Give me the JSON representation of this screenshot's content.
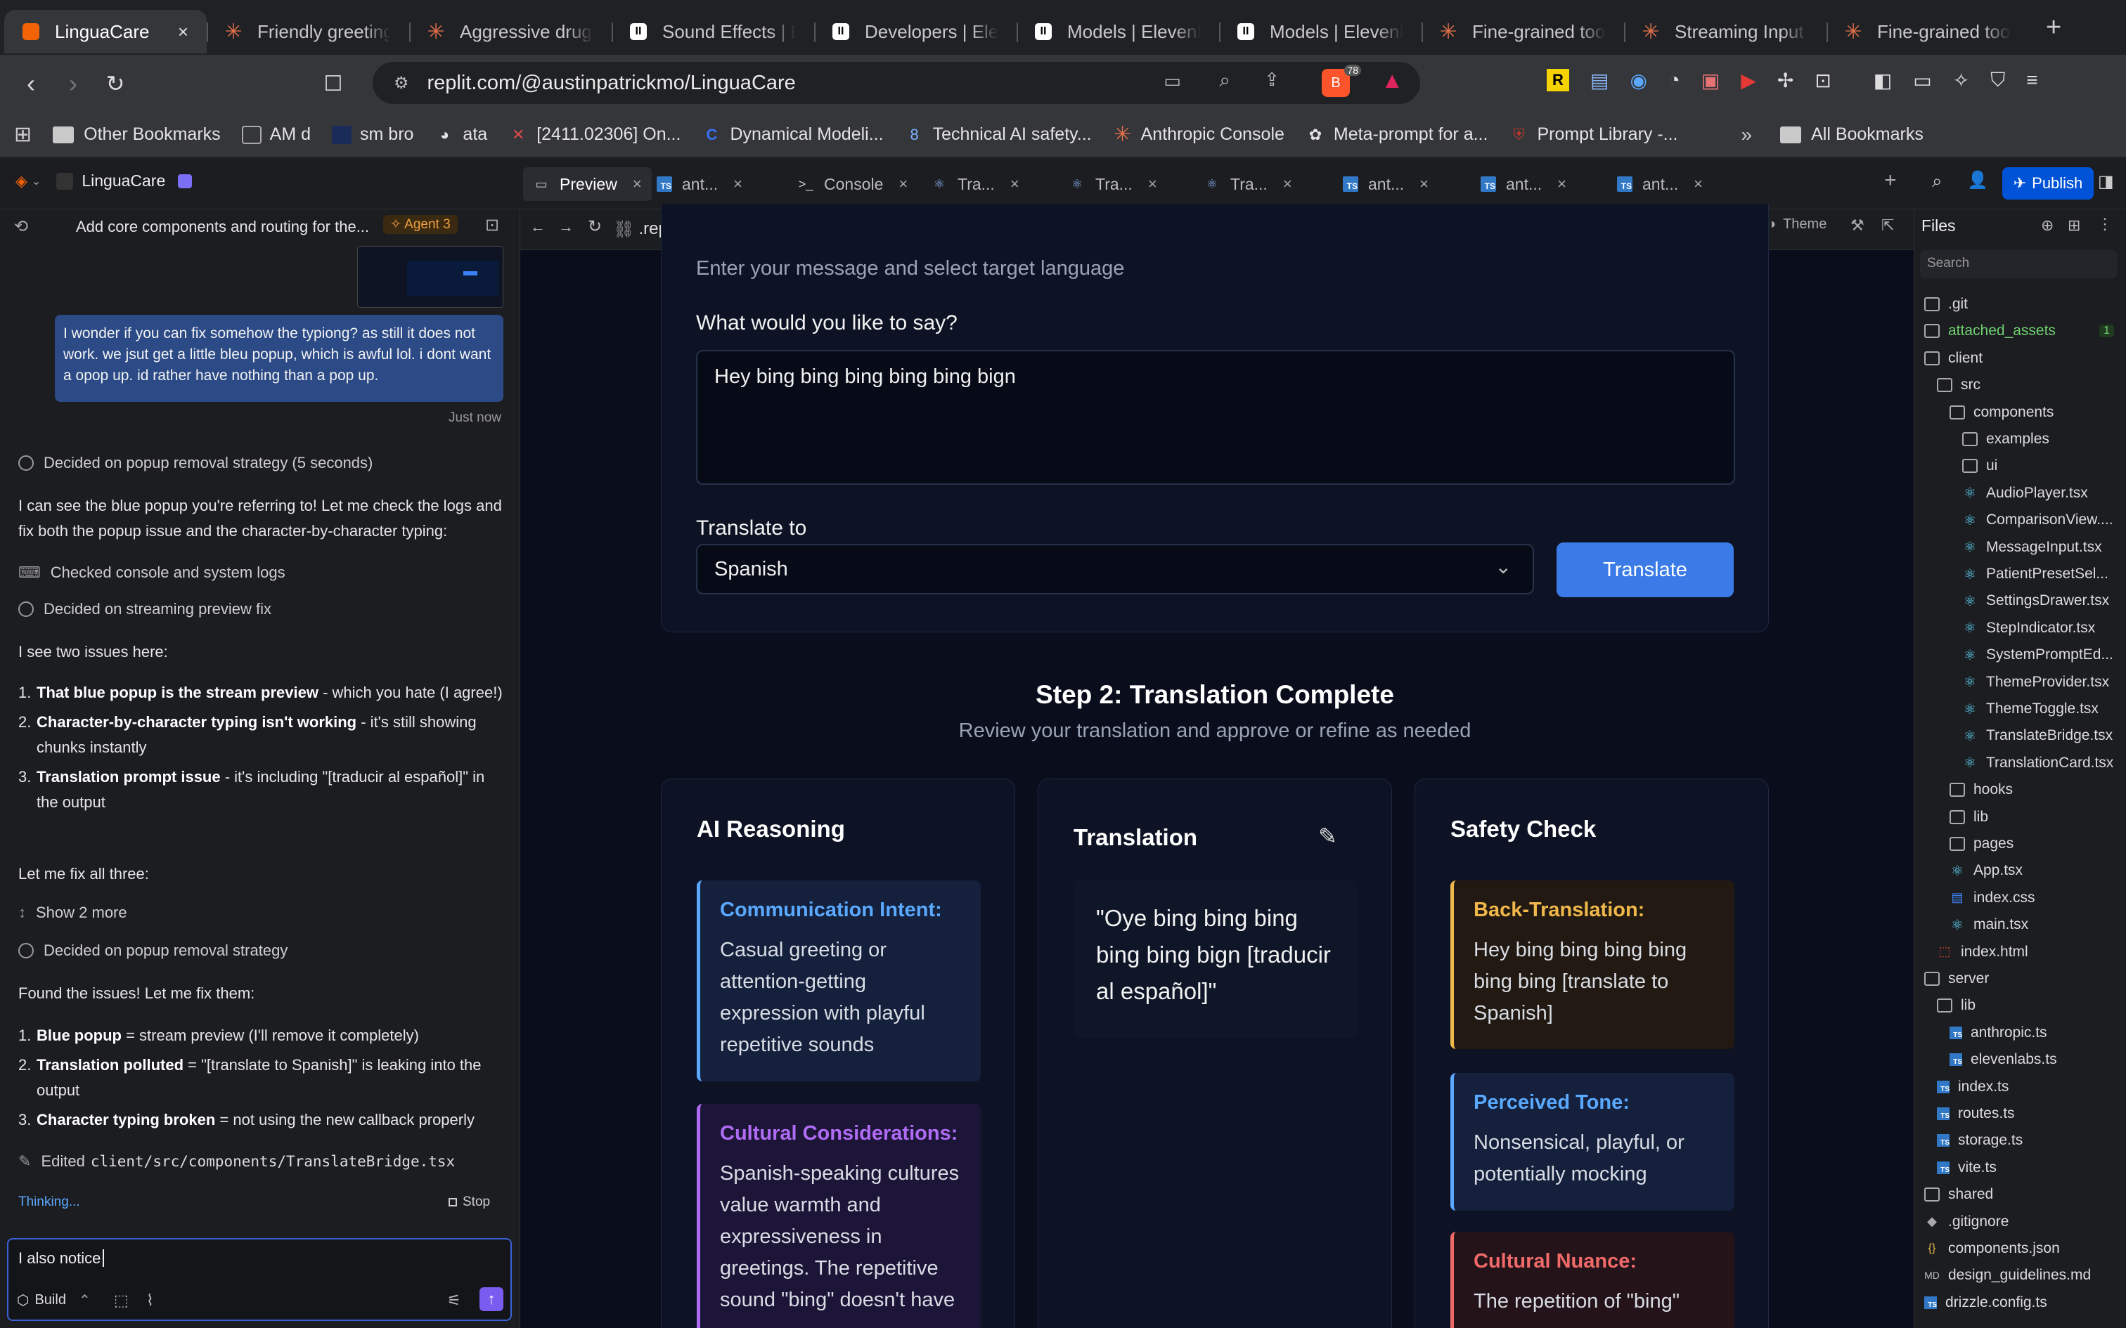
{
  "browser": {
    "tabs": [
      {
        "title": "LinguaCare",
        "icon": "replit",
        "active": true
      },
      {
        "title": "Friendly greeting",
        "icon": "anthropic"
      },
      {
        "title": "Aggressive drug",
        "icon": "anthropic"
      },
      {
        "title": "Sound Effects | E",
        "icon": "elevenlabs"
      },
      {
        "title": "Developers | Elev",
        "icon": "elevenlabs"
      },
      {
        "title": "Models | ElevenL",
        "icon": "elevenlabs"
      },
      {
        "title": "Models | ElevenL",
        "icon": "elevenlabs"
      },
      {
        "title": "Fine-grained too",
        "icon": "anthropic"
      },
      {
        "title": "Streaming Input",
        "icon": "anthropic"
      },
      {
        "title": "Fine-grained too",
        "icon": "anthropic"
      }
    ],
    "url": "replit.com/@austinpatrickmo/LinguaCare",
    "extension_badge": "78",
    "bookmarks": [
      "Other Bookmarks",
      "AM d",
      "sm bro",
      "ata",
      "[2411.02306] On...",
      "Dynamical Modeli...",
      "Technical AI safety...",
      "Anthropic Console",
      "Meta-prompt for a...",
      "Prompt Library -..."
    ],
    "all_bookmarks": "All Bookmarks"
  },
  "replit": {
    "project_name": "LinguaCare",
    "tabs": [
      "Preview",
      "ant...",
      "Console",
      "Tra...",
      "Tra...",
      "Tra...",
      "ant...",
      "ant...",
      "ant..."
    ],
    "publish_label": "Publish",
    "preview_url": ".replit.dev/",
    "theme_label": "Theme"
  },
  "chat": {
    "header_title": "Add core components and routing for the...",
    "agent_badge": "Agent 3",
    "user_message": "I wonder if you can fix somehow the typiong? as still it does not work. we jsut get a little bleu popup, which is awful lol. i dont want a opop up. id rather have nothing than a pop up.",
    "timestamp": "Just now",
    "step1": "Decided on popup removal strategy (5 seconds)",
    "para1": "I can see the blue popup you're referring to! Let me check the logs and fix both the popup issue and the character-by-character typing:",
    "step2": "Checked console and system logs",
    "step3": "Decided on streaming preview fix",
    "para2": "I see two issues here:",
    "issues": [
      {
        "num": "1.",
        "bold": "That blue popup is the stream preview",
        "rest": " - which you hate (I agree!)"
      },
      {
        "num": "2.",
        "bold": "Character-by-character typing isn't working",
        "rest": " - it's still showing chunks instantly"
      },
      {
        "num": "3.",
        "bold": "Translation prompt issue",
        "rest": " - it's including \"[traducir al español]\" in the output"
      }
    ],
    "para3": "Let me fix all three:",
    "show_more": "Show 2 more",
    "step4": "Decided on popup removal strategy",
    "para4": "Found the issues! Let me fix them:",
    "fixes": [
      {
        "num": "1.",
        "bold": "Blue popup",
        "rest": " = stream preview (I'll remove it completely)"
      },
      {
        "num": "2.",
        "bold": "Translation polluted",
        "rest": " = \"[translate to Spanish]\" is leaking into the output"
      },
      {
        "num": "3.",
        "bold": "Character typing broken",
        "rest": " = not using the new callback properly"
      }
    ],
    "edited_prefix": "Edited",
    "edited_file": "client/src/components/TranslateBridge.tsx",
    "thinking": "Thinking...",
    "stop": "Stop",
    "input_value": "I also notice",
    "build_label": "Build"
  },
  "app": {
    "step1_subtitle": "Enter your message and select target language",
    "message_label": "What would you like to say?",
    "message_value": "Hey bing bing bing bing bing bign",
    "translate_to_label": "Translate to",
    "language_value": "Spanish",
    "translate_button": "Translate",
    "step2_title": "Step 2: Translation Complete",
    "step2_subtitle": "Review your translation and approve or refine as needed",
    "reasoning": {
      "title": "AI Reasoning",
      "blocks": [
        {
          "heading": "Communication Intent:",
          "text": "Casual greeting or attention-getting expression with playful repetitive sounds"
        },
        {
          "heading": "Cultural Considerations:",
          "text": "Spanish-speaking cultures value warmth and expressiveness in greetings. The repetitive sound \"bing\" doesn't have"
        }
      ]
    },
    "translation": {
      "title": "Translation",
      "text": "\"Oye bing bing bing bing bing bign [traducir al español]\""
    },
    "safety": {
      "title": "Safety Check",
      "blocks": [
        {
          "heading": "Back-Translation:",
          "text": "Hey bing bing bing bing bing bing [translate to Spanish]"
        },
        {
          "heading": "Perceived Tone:",
          "text": "Nonsensical, playful, or potentially mocking"
        },
        {
          "heading": "Cultural Nuance:",
          "text": "The repetition of \"bing\""
        }
      ]
    }
  },
  "files": {
    "title": "Files",
    "search_placeholder": "Search",
    "tree": [
      {
        "name": ".git",
        "type": "dir",
        "depth": 0
      },
      {
        "name": "attached_assets",
        "type": "dir",
        "depth": 0,
        "badge": "1",
        "color": "#6fcf6f"
      },
      {
        "name": "client",
        "type": "dir",
        "depth": 0
      },
      {
        "name": "src",
        "type": "dir",
        "depth": 1
      },
      {
        "name": "components",
        "type": "dir",
        "depth": 2
      },
      {
        "name": "examples",
        "type": "dir",
        "depth": 3
      },
      {
        "name": "ui",
        "type": "dir",
        "depth": 3
      },
      {
        "name": "AudioPlayer.tsx",
        "type": "react",
        "depth": 3
      },
      {
        "name": "ComparisonView....",
        "type": "react",
        "depth": 3
      },
      {
        "name": "MessageInput.tsx",
        "type": "react",
        "depth": 3
      },
      {
        "name": "PatientPresetSel...",
        "type": "react",
        "depth": 3
      },
      {
        "name": "SettingsDrawer.tsx",
        "type": "react",
        "depth": 3
      },
      {
        "name": "StepIndicator.tsx",
        "type": "react",
        "depth": 3
      },
      {
        "name": "SystemPromptEd...",
        "type": "react",
        "depth": 3
      },
      {
        "name": "ThemeProvider.tsx",
        "type": "react",
        "depth": 3
      },
      {
        "name": "ThemeToggle.tsx",
        "type": "react",
        "depth": 3
      },
      {
        "name": "TranslateBridge.tsx",
        "type": "react",
        "depth": 3
      },
      {
        "name": "TranslationCard.tsx",
        "type": "react",
        "depth": 3
      },
      {
        "name": "hooks",
        "type": "dir",
        "depth": 2
      },
      {
        "name": "lib",
        "type": "dir",
        "depth": 2
      },
      {
        "name": "pages",
        "type": "dir",
        "depth": 2
      },
      {
        "name": "App.tsx",
        "type": "react",
        "depth": 2
      },
      {
        "name": "index.css",
        "type": "css",
        "depth": 2
      },
      {
        "name": "main.tsx",
        "type": "react",
        "depth": 2
      },
      {
        "name": "index.html",
        "type": "html",
        "depth": 1
      },
      {
        "name": "server",
        "type": "dir",
        "depth": 0
      },
      {
        "name": "lib",
        "type": "dir",
        "depth": 1
      },
      {
        "name": "anthropic.ts",
        "type": "ts",
        "depth": 2
      },
      {
        "name": "elevenlabs.ts",
        "type": "ts",
        "depth": 2
      },
      {
        "name": "index.ts",
        "type": "ts",
        "depth": 1
      },
      {
        "name": "routes.ts",
        "type": "ts",
        "depth": 1
      },
      {
        "name": "storage.ts",
        "type": "ts",
        "depth": 1
      },
      {
        "name": "vite.ts",
        "type": "ts",
        "depth": 1
      },
      {
        "name": "shared",
        "type": "dir",
        "depth": 0
      },
      {
        "name": ".gitignore",
        "type": "git",
        "depth": 0
      },
      {
        "name": "components.json",
        "type": "json",
        "depth": 0
      },
      {
        "name": "design_guidelines.md",
        "type": "md",
        "depth": 0
      },
      {
        "name": "drizzle.config.ts",
        "type": "ts",
        "depth": 0
      }
    ]
  },
  "colors": {
    "accent_blue": "#3b82f6",
    "reasoning_intent": "#5aa9ff",
    "reasoning_cultural": "#b06cf5",
    "safety_back": "#f0b84a",
    "safety_tone": "#5aa9ff",
    "safety_nuance": "#f06a6a"
  }
}
